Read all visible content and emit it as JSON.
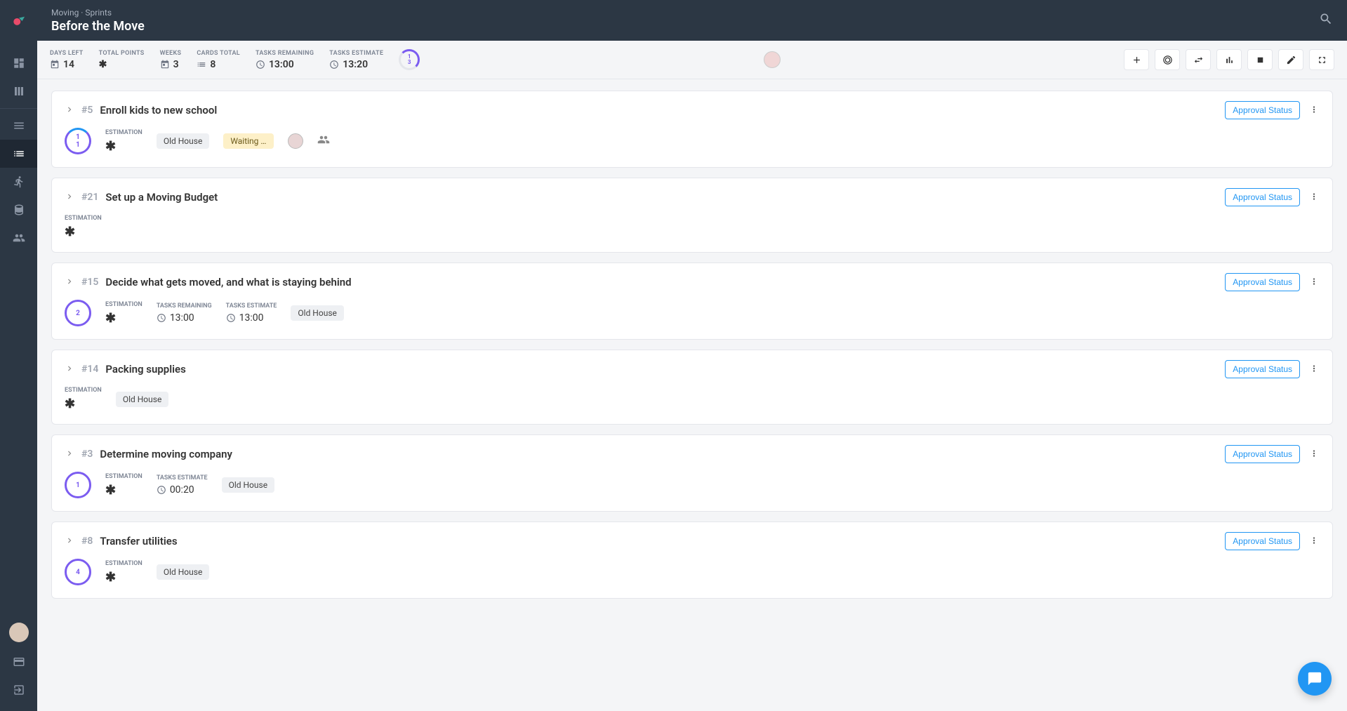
{
  "header": {
    "breadcrumb": "Moving · Sprints",
    "title": "Before the Move"
  },
  "stats": {
    "days_left_label": "DAYS LEFT",
    "days_left": "14",
    "total_points_label": "TOTAL POINTS",
    "weeks_label": "WEEKS",
    "weeks": "3",
    "cards_total_label": "CARDS TOTAL",
    "cards_total": "8",
    "tasks_remaining_label": "TASKS REMAINING",
    "tasks_remaining": "13:00",
    "tasks_estimate_label": "TASKS ESTIMATE",
    "tasks_estimate": "13:20",
    "ring_top": "1",
    "ring_bottom": "3"
  },
  "common": {
    "approval": "Approval Status",
    "estimation": "ESTIMATION",
    "tasks_remaining": "TASKS REMAINING",
    "tasks_estimate": "TASKS ESTIMATE"
  },
  "cards": [
    {
      "id": "#5",
      "title": "Enroll kids to new school",
      "ring": [
        "1",
        "1"
      ],
      "tags": [
        {
          "text": "Old House",
          "class": ""
        },
        {
          "text": "Waiting Re…",
          "class": "yellow"
        }
      ],
      "show_assignee": true,
      "show_group": true,
      "metas": []
    },
    {
      "id": "#21",
      "title": "Set up a Moving Budget",
      "ring": null,
      "tags": [],
      "show_assignee": false,
      "show_group": false,
      "metas": []
    },
    {
      "id": "#15",
      "title": "Decide what gets moved, and what is staying behind",
      "ring": [
        "2"
      ],
      "tags": [
        {
          "text": "Old House",
          "class": ""
        }
      ],
      "show_assignee": false,
      "show_group": false,
      "metas": [
        {
          "label_key": "tasks_remaining",
          "icon": "clock",
          "val": "13:00"
        },
        {
          "label_key": "tasks_estimate",
          "icon": "schedule",
          "val": "13:00"
        }
      ]
    },
    {
      "id": "#14",
      "title": "Packing supplies",
      "ring": null,
      "tags": [
        {
          "text": "Old House",
          "class": ""
        }
      ],
      "show_assignee": false,
      "show_group": false,
      "metas": []
    },
    {
      "id": "#3",
      "title": "Determine moving company",
      "ring": [
        "1"
      ],
      "tags": [
        {
          "text": "Old House",
          "class": ""
        }
      ],
      "show_assignee": false,
      "show_group": false,
      "metas": [
        {
          "label_key": "tasks_estimate",
          "icon": "schedule",
          "val": "00:20"
        }
      ]
    },
    {
      "id": "#8",
      "title": "Transfer utilities",
      "ring": [
        "4"
      ],
      "tags": [
        {
          "text": "Old House",
          "class": ""
        }
      ],
      "show_assignee": false,
      "show_group": false,
      "metas": []
    }
  ]
}
